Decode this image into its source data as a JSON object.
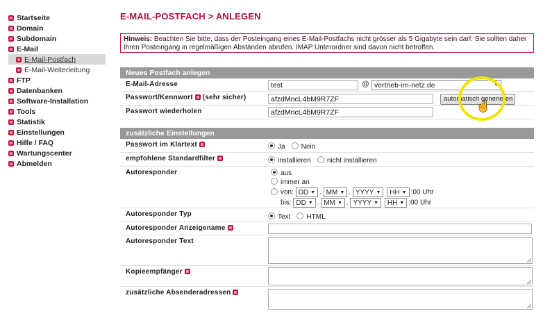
{
  "sidebar": {
    "items": [
      {
        "label": "Startseite"
      },
      {
        "label": "Domain"
      },
      {
        "label": "Subdomain"
      },
      {
        "label": "E-Mail"
      },
      {
        "label": "E-Mail-Postfach"
      },
      {
        "label": "E-Mail-Weiterleitung"
      },
      {
        "label": "FTP"
      },
      {
        "label": "Datenbanken"
      },
      {
        "label": "Software-Installation"
      },
      {
        "label": "Tools"
      },
      {
        "label": "Statistik"
      },
      {
        "label": "Einstellungen"
      },
      {
        "label": "Hilfe / FAQ"
      },
      {
        "label": "Wartungscenter"
      },
      {
        "label": "Abmelden"
      }
    ]
  },
  "page": {
    "title": "E-MAIL-POSTFACH > ANLEGEN"
  },
  "hint": {
    "prefix": "Hinweis:",
    "text": " Beachten Sie bitte, dass der Posteingang eines E-Mail-Postfachs nicht grösser als 5 Gigabyte sein darf. Sie sollten daher Ihren Posteingang in regelmäßigen Abständen abrufen. IMAP Unterordner sind davon nicht betroffen."
  },
  "new_mailbox": {
    "header": "Neues Postfach anlegen",
    "email_label": "E-Mail-Adresse",
    "email_value": "test",
    "at": "@",
    "domain_value": "vertrieb-im-netz.de",
    "password_label": "Passwort/Kennwort",
    "password_suffix": "(sehr sicher)",
    "password_value": "afzdMncL4bM9R7ZF",
    "generate_button": "automatisch generieren",
    "password_repeat_label": "Passwort wiederholen",
    "password_repeat_value": "afzdMncL4bM9R7ZF"
  },
  "additional": {
    "header": "zusätzliche Einstellungen",
    "plaintext_label": "Passwort im Klartext",
    "plaintext_yes": "Ja",
    "plaintext_no": "Nein",
    "filter_label": "empfohlene Standardfilter",
    "filter_install": "installieren",
    "filter_noinstall": "nicht installieren",
    "autoresponder_label": "Autoresponder",
    "ar_off": "aus",
    "ar_always": "immer an",
    "ar_from": "von:",
    "ar_to": "bis:",
    "dd": "DD",
    "mm": "MM",
    "yyyy": "YYYY",
    "hh": "HH",
    "minutes": ":00 Uhr",
    "ar_type_label": "Autoresponder Typ",
    "ar_type_text": "Text",
    "ar_type_html": "HTML",
    "ar_name_label": "Autoresponder Anzeigename",
    "ar_text_label": "Autoresponder Text",
    "cc_label": "Kopieempfänger",
    "sender_label": "zusätzliche Absenderadressen"
  },
  "colors": {
    "accent": "#b0123c",
    "section_header": "#999999",
    "highlight": "#f2e600"
  }
}
